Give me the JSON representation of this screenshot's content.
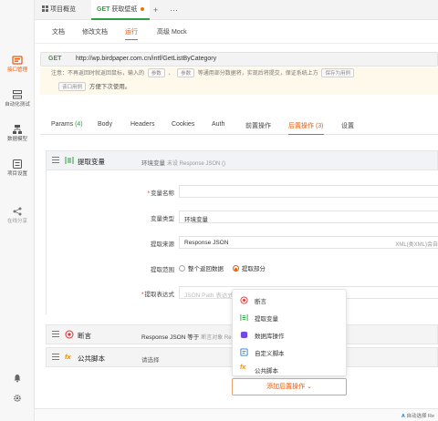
{
  "sidebar": {
    "items": [
      {
        "label": "接口管理",
        "icon": "api-icon",
        "active": true
      },
      {
        "label": "自动化测试",
        "icon": "automation-icon",
        "active": false
      },
      {
        "label": "数据模型",
        "icon": "data-model-icon",
        "active": false
      },
      {
        "label": "项目设置",
        "icon": "settings-icon",
        "active": false
      },
      {
        "label": "在线分享",
        "icon": "share-icon",
        "active": false
      }
    ]
  },
  "tabs": {
    "overview": "项目概览",
    "request_method": "GET",
    "request_name": "获取壁纸"
  },
  "subtabs": [
    "文档",
    "修改文档",
    "运行",
    "高级 Mock"
  ],
  "request": {
    "method": "GET",
    "url": "http://wp.birdpaper.com.cn/intf/GetListByCategory"
  },
  "notice": {
    "line1_prefix": "注意：不再返回时就返回鼠标，输入的",
    "chip_a": "参数",
    "sep": "、",
    "chip_b": "参数",
    "line1_suffix": "等通用部分数据将，实现后将提交，保证系统上方",
    "chip_c": "保存为用例",
    "line2_chip": "该口用例",
    "line2_text": "方便下次使用。"
  },
  "param_tabs": [
    {
      "label": "Params",
      "count": "(4)"
    },
    {
      "label": "Body",
      "count": ""
    },
    {
      "label": "Headers",
      "count": ""
    },
    {
      "label": "Cookies",
      "count": ""
    },
    {
      "label": "Auth",
      "count": ""
    },
    {
      "label": "前置操作",
      "count": ""
    },
    {
      "label": "后置操作",
      "count": "(3)"
    },
    {
      "label": "设置",
      "count": ""
    }
  ],
  "extract": {
    "title": "提取变量",
    "desc": "环境变量",
    "desc_sub": "未设 Response JSON ()",
    "fields": {
      "var_name_label": "变量名称",
      "var_type_label": "变量类型",
      "var_type_value": "环境变量",
      "source_label": "提取来源",
      "source_value": "Response JSON",
      "source_hint": "XML(类XML)会自",
      "scope_label": "提取范围",
      "scope_opt1": "整个返回数据",
      "scope_opt2": "提取部分",
      "expr_label": "提取表达式",
      "expr_placeholder": "JSON Path 表达式"
    }
  },
  "assert": {
    "title": "断言",
    "desc": "Response JSON 等于",
    "desc_sub": "断言对象 Re"
  },
  "script": {
    "title": "公共脚本",
    "desc": "请选择"
  },
  "dropdown": {
    "items": [
      {
        "label": "断言",
        "icon": "assert-icon",
        "color": "#e03131"
      },
      {
        "label": "提取变量",
        "icon": "extract-icon",
        "color": "#2f9e44"
      },
      {
        "label": "数据库操作",
        "icon": "database-icon",
        "color": "#7048e8"
      },
      {
        "label": "自定义脚本",
        "icon": "script-icon",
        "color": "#1c7ed6"
      },
      {
        "label": "公共脚本",
        "icon": "fx-icon",
        "color": "#f08c00"
      }
    ]
  },
  "add_button": "添加后置操作",
  "status": {
    "text": "自动选择 Re"
  },
  "colors": {
    "accent": "#e8590c",
    "get_method": "#2f9e44"
  }
}
